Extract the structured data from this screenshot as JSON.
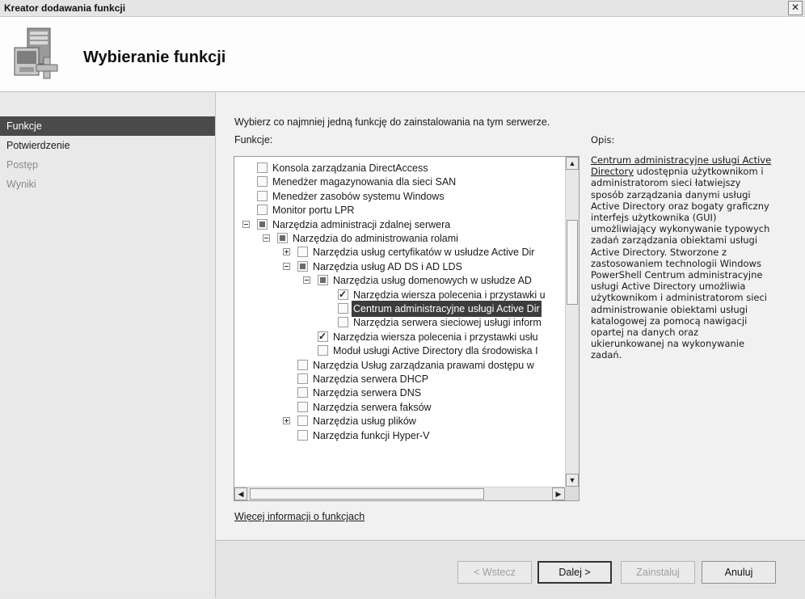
{
  "window": {
    "title": "Kreator dodawania funkcji",
    "close_glyph": "✕"
  },
  "header": {
    "title": "Wybieranie funkcji",
    "icon": "server-add-icon"
  },
  "sidebar": {
    "steps": [
      {
        "label": "Funkcje",
        "state": "active"
      },
      {
        "label": "Potwierdzenie",
        "state": "normal"
      },
      {
        "label": "Postęp",
        "state": "disabled"
      },
      {
        "label": "Wyniki",
        "state": "disabled"
      }
    ]
  },
  "main": {
    "instruction": "Wybierz co najmniej jedną funkcję do zainstalowania na tym serwerze.",
    "features_label": "Funkcje:",
    "description_label": "Opis:",
    "description_link": "Centrum administracyjne usługi Active Directory",
    "description_lines": [
      " udostępnia użytkownikom i",
      "administratorom sieci łatwiejszy",
      "sposób zarządzania danymi usługi",
      "Active Directory oraz bogaty graficzny",
      "interfejs użytkownika (GUI)",
      "umożliwiający wykonywanie typowych",
      "zadań zarządzania obiektami usługi",
      "Active Directory. Stworzone z",
      "zastosowaniem technologii Windows",
      "PowerShell Centrum administracyjne",
      "usługi Active Directory umożliwia",
      "użytkownikom i administratorom sieci",
      "administrowanie obiektami usługi",
      "katalogowej za pomocą nawigacji",
      "opartej na danych oraz",
      "ukierunkowanej na wykonywanie",
      "zadań."
    ],
    "more_info_link": "Więcej informacji o funkcjach"
  },
  "tree": {
    "items": [
      {
        "label": "Konsola zarządzania DirectAccess",
        "level": 0,
        "expander": "none",
        "check": "unchecked",
        "selected": false
      },
      {
        "label": "Menedżer magazynowania dla sieci SAN",
        "level": 0,
        "expander": "none",
        "check": "unchecked",
        "selected": false
      },
      {
        "label": "Menedżer zasobów systemu Windows",
        "level": 0,
        "expander": "none",
        "check": "unchecked",
        "selected": false
      },
      {
        "label": "Monitor portu LPR",
        "level": 0,
        "expander": "none",
        "check": "unchecked",
        "selected": false
      },
      {
        "label": "Narzędzia administracji zdalnej serwera",
        "level": 0,
        "expander": "minus",
        "check": "mixed",
        "selected": false
      },
      {
        "label": "Narzędzia do administrowania rolami",
        "level": 1,
        "expander": "minus",
        "check": "mixed",
        "selected": false
      },
      {
        "label": "Narzędzia usług certyfikatów w usłudze Active Dir",
        "level": 2,
        "expander": "plus",
        "check": "unchecked",
        "selected": false
      },
      {
        "label": "Narzędzia usług AD DS i AD LDS",
        "level": 2,
        "expander": "minus",
        "check": "mixed",
        "selected": false
      },
      {
        "label": "Narzędzia usług domenowych w usłudze AD",
        "level": 3,
        "expander": "minus",
        "check": "mixed",
        "selected": false
      },
      {
        "label": "Narzędzia wiersza polecenia i przystawki u",
        "level": 4,
        "expander": "none",
        "check": "checked",
        "selected": false
      },
      {
        "label": "Centrum administracyjne usługi Active Dir",
        "level": 4,
        "expander": "none",
        "check": "unchecked",
        "selected": true
      },
      {
        "label": "Narzędzia serwera sieciowej usługi inform",
        "level": 4,
        "expander": "none",
        "check": "unchecked",
        "selected": false
      },
      {
        "label": "Narzędzia wiersza polecenia i przystawki usłu",
        "level": 3,
        "expander": "none",
        "check": "checked",
        "selected": false
      },
      {
        "label": "Moduł usługi Active Directory dla środowiska I",
        "level": 3,
        "expander": "none",
        "check": "unchecked",
        "selected": false
      },
      {
        "label": "Narzędzia Usług zarządzania prawami dostępu w",
        "level": 2,
        "expander": "none",
        "check": "unchecked",
        "selected": false
      },
      {
        "label": "Narzędzia serwera DHCP",
        "level": 2,
        "expander": "none",
        "check": "unchecked",
        "selected": false
      },
      {
        "label": "Narzędzia serwera DNS",
        "level": 2,
        "expander": "none",
        "check": "unchecked",
        "selected": false
      },
      {
        "label": "Narzędzia serwera faksów",
        "level": 2,
        "expander": "none",
        "check": "unchecked",
        "selected": false
      },
      {
        "label": "Narzędzia usług plików",
        "level": 2,
        "expander": "plus",
        "check": "unchecked",
        "selected": false
      },
      {
        "label": "Narzędzia funkcji Hyper-V",
        "level": 2,
        "expander": "none",
        "check": "unchecked",
        "selected": false
      }
    ]
  },
  "footer": {
    "back": "< Wstecz",
    "next": "Dalej >",
    "install": "Zainstaluj",
    "cancel": "Anuluj"
  },
  "colors": {
    "active_step_bg": "#4a4a4a",
    "selection_bg": "#3c3c3c",
    "panel_bg": "#f1f1f1"
  }
}
